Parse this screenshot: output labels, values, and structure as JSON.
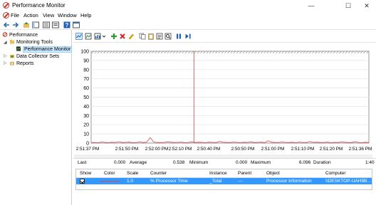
{
  "window": {
    "title": "Performance Monitor",
    "minimize": "—",
    "maximize": "☐",
    "close": "✕"
  },
  "menu": [
    "File",
    "Action",
    "View",
    "Window",
    "Help"
  ],
  "tree": {
    "root": "Performance",
    "monitoring_tools": "Monitoring Tools",
    "performance_monitor": "Performance Monitor",
    "data_collector_sets": "Data Collector Sets",
    "reports": "Reports"
  },
  "chart_data": {
    "type": "line",
    "ylim": [
      0,
      100
    ],
    "y_ticks": [
      0,
      10,
      20,
      30,
      40,
      50,
      60,
      70,
      80,
      90,
      100
    ],
    "x_tick_labels": [
      "2:51:37 PM",
      "2:51:50 PM",
      "2:52:00 PM",
      "2:52:10 PM",
      "2:50:40 PM",
      "2:50:50 PM",
      "2:51:00 PM",
      "2:51:10 PM",
      "2:51:20 PM",
      "2:51:36 PM"
    ],
    "grid": "horizontal",
    "series": [
      {
        "color": "#d94a4a",
        "values": [
          0.5,
          0.6,
          0.4,
          1.2,
          0.8,
          0.5,
          0.9,
          0.7,
          1.5,
          0.6,
          0.8,
          1.0,
          0.5,
          0.7,
          1.2,
          0.6,
          0.9,
          6.0,
          1.1,
          0.7,
          0.6,
          0.8,
          1.4,
          0.9,
          0.6,
          0.8,
          1.0,
          0.5,
          0.7,
          1.3,
          0.6,
          0.9,
          0.8,
          0.5,
          1.0,
          0.7,
          0.6,
          1.8,
          0.9,
          0.7,
          0.6,
          1.1,
          0.8,
          0.5,
          0.9,
          0.7,
          1.3,
          0.6,
          0.8,
          1.0,
          0.5,
          2.5,
          0.9,
          0.6,
          0.7,
          1.2,
          0.8,
          0.6,
          0.9,
          0.5,
          1.1,
          0.7,
          0.6,
          1.7,
          0.8,
          0.9,
          0.6,
          0.7,
          1.0,
          0.5,
          0.8,
          0.6,
          1.2,
          0.9,
          0.7,
          0.6,
          1.4,
          0.8,
          0.5,
          0.9,
          0.7
        ]
      }
    ],
    "cursor_fraction": 0.37
  },
  "stats": {
    "last_label": "Last",
    "last": "0.000",
    "average_label": "Average",
    "average": "0.538",
    "minimum_label": "Minimum",
    "minimum": "0.000",
    "maximum_label": "Maximum",
    "maximum": "6.096",
    "duration_label": "Duration",
    "duration": "1:40"
  },
  "grid": {
    "headers": {
      "show": "Show",
      "color": "Color",
      "scale": "Scale",
      "counter": "Counter",
      "instance": "Instance",
      "parent": "Parent",
      "object": "Object",
      "computer": "Computer"
    },
    "rows": [
      {
        "scale": "1.0",
        "counter": "% Processor Time",
        "instance": "_Total",
        "parent": "---",
        "object": "Processor Information",
        "computer": "\\\\DESKTOP-UAH9B..."
      }
    ]
  }
}
